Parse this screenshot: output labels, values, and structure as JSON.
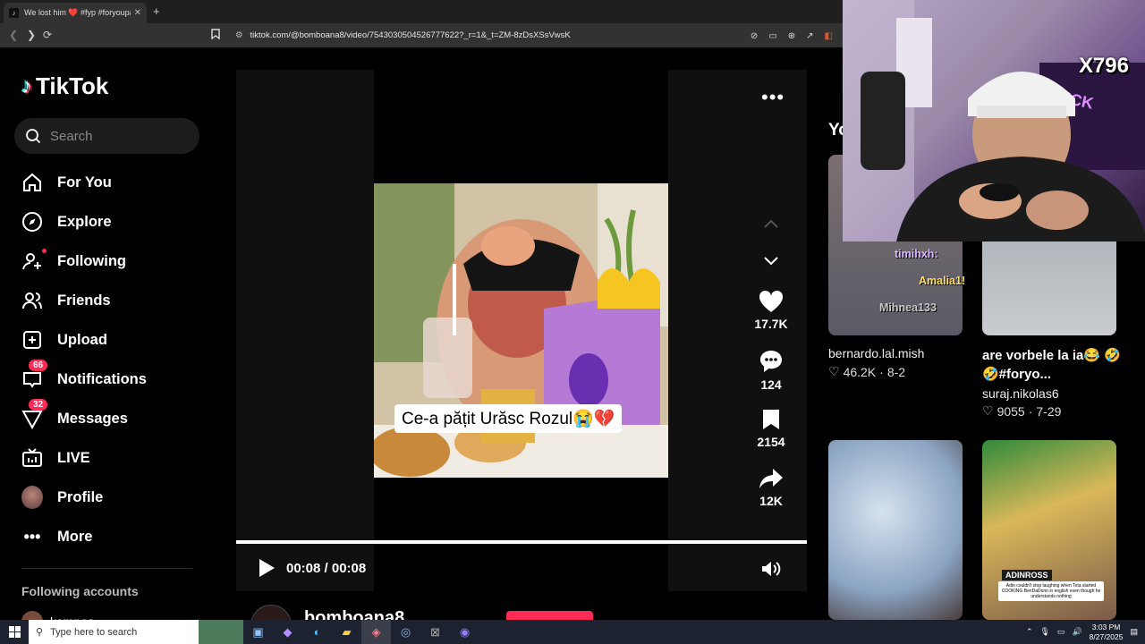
{
  "browser": {
    "tab_title": "We lost him ❤️ #fyp #foryoupag",
    "url": "tiktok.com/@bomboana8/video/7543030504526777622?_r=1&_t=ZM-8zDsXSsVwsK"
  },
  "brand": {
    "name": "TikTok"
  },
  "search": {
    "placeholder": "Search"
  },
  "nav": {
    "for_you": "For You",
    "explore": "Explore",
    "following": "Following",
    "friends": "Friends",
    "upload": "Upload",
    "notifications": "Notifications",
    "notifications_badge": "66",
    "messages": "Messages",
    "messages_badge": "32",
    "live": "LIVE",
    "profile": "Profile",
    "more": "More"
  },
  "following_accounts": {
    "title": "Following accounts",
    "first": "kempes"
  },
  "video": {
    "caption": "Ce-a pățit Urăsc Rozul😭💔",
    "likes": "17.7K",
    "comments": "124",
    "saves": "2154",
    "shares": "12K",
    "time": "00:08 / 00:08",
    "author": "bomboana8"
  },
  "right_column": {
    "title": "Yo",
    "items": [
      {
        "author": "bernardo.lal.mish",
        "likes": "46.2K",
        "date": "8-2"
      },
      {
        "caption": "are vorbele la ia😂 🤣🤣#foryo...",
        "author": "suraj.nikolas6",
        "likes": "9055",
        "date": "7-29"
      }
    ],
    "thumb4_overlay_tag": "ADINROSS",
    "thumb4_overlay_text": "Adin couldn't stop laughing when Tota started COOKING BenDaDonn in english even though he understands nothing"
  },
  "stream": {
    "counter": "X796",
    "chat": [
      "timihxh:",
      "Amalia1!",
      "Mihnea133"
    ]
  },
  "taskbar": {
    "search_placeholder": "Type here to search",
    "time": "3:03 PM",
    "date": "8/27/2025"
  },
  "colors": {
    "accent": "#fe2c55",
    "bg": "#000000"
  }
}
